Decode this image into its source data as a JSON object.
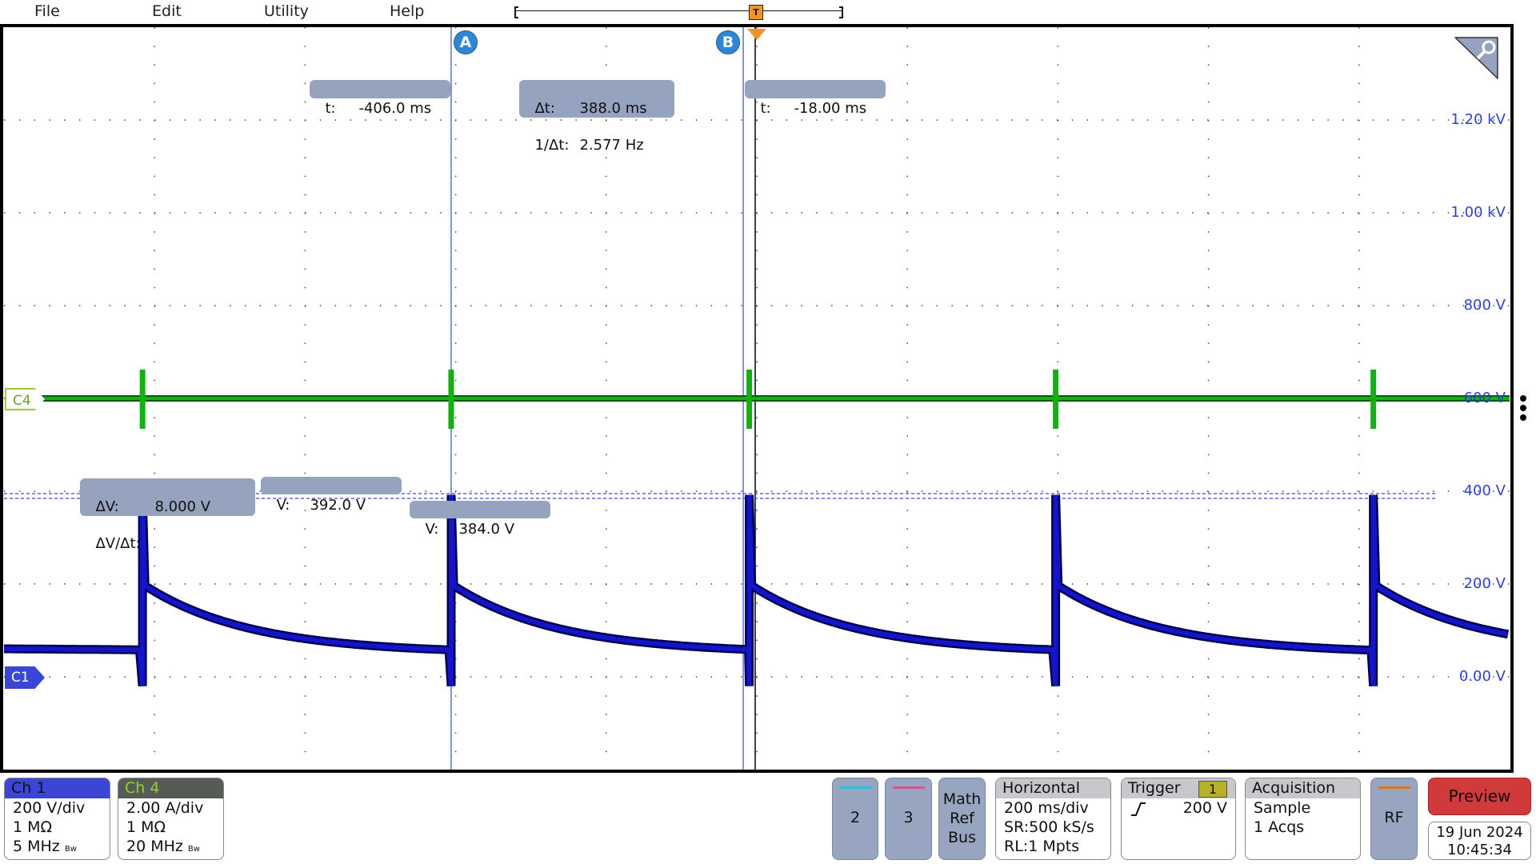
{
  "menu": {
    "items": [
      "File",
      "Edit",
      "Utility",
      "Help"
    ]
  },
  "trigger_marker": "T",
  "cursors": {
    "a_label": "A",
    "b_label": "B",
    "a_readout": {
      "label": "t:",
      "value": "-406.0 ms"
    },
    "b_readout": {
      "label": "t:",
      "value": "-18.00 ms"
    },
    "delta_readout": {
      "dt_label": "Δt:",
      "dt_value": "388.0 ms",
      "inv_label": "1/Δt:",
      "inv_value": "2.577 Hz"
    },
    "dv_readout": {
      "dv_label": "ΔV:",
      "dv_value": "8.000 V",
      "dvdt_label": "ΔV/Δt:",
      "dvdt_value": ""
    },
    "va_readout": {
      "label": "V:",
      "value": "392.0 V"
    },
    "vb_readout": {
      "label": "V:",
      "value": "384.0 V"
    }
  },
  "vertical_scale_labels": [
    "1.20 kV",
    "1.00 kV",
    "800 V",
    "600 V",
    "400 V",
    "200 V",
    "0.00 V"
  ],
  "channel_markers": {
    "c1": "C1",
    "c4": "C4"
  },
  "colors": {
    "ch1": "#1414c8",
    "ch4": "#12b012",
    "ch2": "#22c3dd",
    "ch3": "#d9558c",
    "rf": "#e0731c",
    "preview": "#d03a3a",
    "cursor": "#2f86d4",
    "trigger": "#f0932b"
  },
  "bottom": {
    "ch1": {
      "title": "Ch 1",
      "scale": "200 V/div",
      "impedance": "1 MΩ",
      "bandwidth": "5 MHz",
      "bw_tag": "Bw"
    },
    "ch4": {
      "title": "Ch 4",
      "scale": "2.00 A/div",
      "impedance": "1 MΩ",
      "bandwidth": "20 MHz",
      "bw_tag": "Bw"
    },
    "btn2": "2",
    "btn3": "3",
    "math": [
      "Math",
      "Ref",
      "Bus"
    ],
    "horizontal": {
      "title": "Horizontal",
      "scale": "200 ms/div",
      "sr": "SR:500 kS/s",
      "rl": "RL:1 Mpts"
    },
    "trigger": {
      "title": "Trigger",
      "source": "1",
      "slope_icon": "rising-edge",
      "level": "200 V"
    },
    "acquisition": {
      "title": "Acquisition",
      "mode": "Sample",
      "count": "1 Acqs"
    },
    "rf": "RF",
    "preview": "Preview",
    "date": "19 Jun 2024",
    "time": "10:45:34"
  }
}
